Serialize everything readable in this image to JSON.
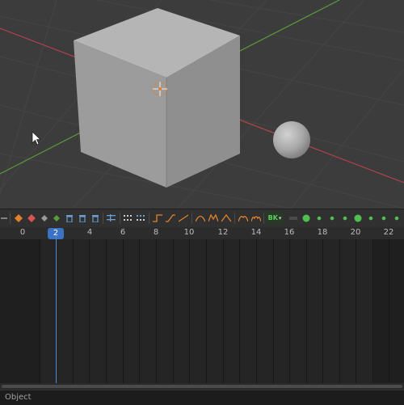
{
  "timeline": {
    "current_frame": "2",
    "ticks": [
      "0",
      "4",
      "6",
      "8",
      "10",
      "12",
      "14",
      "16",
      "18",
      "20",
      "22"
    ],
    "bake_label": "BK",
    "bake_arrow": "▾"
  },
  "status_bar": {
    "mode_label": "Object"
  },
  "icons": {
    "keyframe_add": "diamond-orange-icon",
    "keyframe_delete": "diamond-red-icon",
    "trash": "trash-icon",
    "interpolation": "curve-icon",
    "record": "record-dot-icon"
  },
  "colors": {
    "viewport_bg": "#3c3c3c",
    "x_axis": "#b5424a",
    "y_axis": "#5b9b3a",
    "accent": "#3b73c4",
    "status_green": "#4fbf4f",
    "keyframe_orange": "#e0822a"
  }
}
